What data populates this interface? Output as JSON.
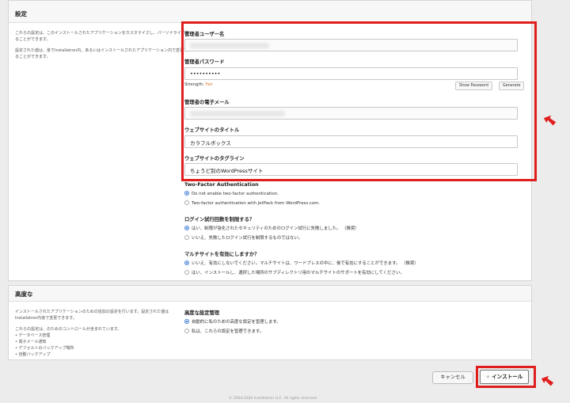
{
  "settings": {
    "title": "設定",
    "desc1": "これらの設定は、このインストールされたアプリケーションをカスタマイズし、パーソナライズすることができます。",
    "desc2": "設定された値は、後でInstallatron内、あるいはインストールされたアプリケーション内で変更することができます。",
    "admin_user_label": "管理者ユーザー名",
    "admin_pass_label": "管理者パスワード",
    "admin_pass_value": "••••••••••",
    "strength_label": "Strength:",
    "strength_value": "Fair",
    "show_password": "Show Password",
    "generate": "Generate",
    "admin_email_label": "管理者の電子メール",
    "site_title_label": "ウェブサイトのタイトル",
    "site_title_value": "カラフルボックス",
    "tagline_label": "ウェブサイトのタグライン",
    "tagline_value": "ちょうど別のWordPressサイト",
    "two_factor_label": "Two-Factor Authentication",
    "two_factor_opt1": "Do not enable two-factor authentication.",
    "two_factor_opt2": "Two-factor authentication with JetPack from WordPress.com.",
    "login_limit_label": "ログイン試行回数を制限する？",
    "login_limit_opt1": "はい、制限が強化されたセキュリティのためのログイン試行に失敗しました。 （推奨）",
    "login_limit_opt2": "いいえ、失敗したログイン試行を制限するものではない。",
    "multisite_label": "マルチサイトを有効にしますか？",
    "multisite_opt1": "いいえ、有効にしないでください。マルチサイトは、ワードプレスの中に、後で有効にすることができます。 （推奨）",
    "multisite_opt2": "はい、インストールし、選択した場所のサブディレクトリ用のマルチサイトのサポートを有効にしてください。"
  },
  "advanced": {
    "title": "高度な",
    "desc1": "インストールされたアプリケーションのための追加の設定を行います。設定された値はInstallatron内後で変更できます。",
    "desc2": "これらの設定は、のためのコントロールが含まれています。",
    "items": [
      "データベース管理",
      "電子メール通知",
      "デフォルトのバックアップ場所",
      "自動バックアップ"
    ],
    "manage_label": "高度な設定管理",
    "manage_opt1": "自動的に私のための高度な設定を管理します。",
    "manage_opt2": "私は、これらの設定を管理できます。"
  },
  "buttons": {
    "cancel": "キャンセル",
    "install_icon": "+",
    "install": "インストール"
  },
  "footer": "© 2004-2020 Installatron LLC. All rights reserved.",
  "colors": {
    "highlight": "#e01e1e",
    "radio_selected": "#3a7bd5",
    "strength_fair": "#e07a2e"
  },
  "icons": {
    "arrow_settings": "red-pointer-arrow-icon",
    "arrow_install": "red-pointer-arrow-icon"
  }
}
